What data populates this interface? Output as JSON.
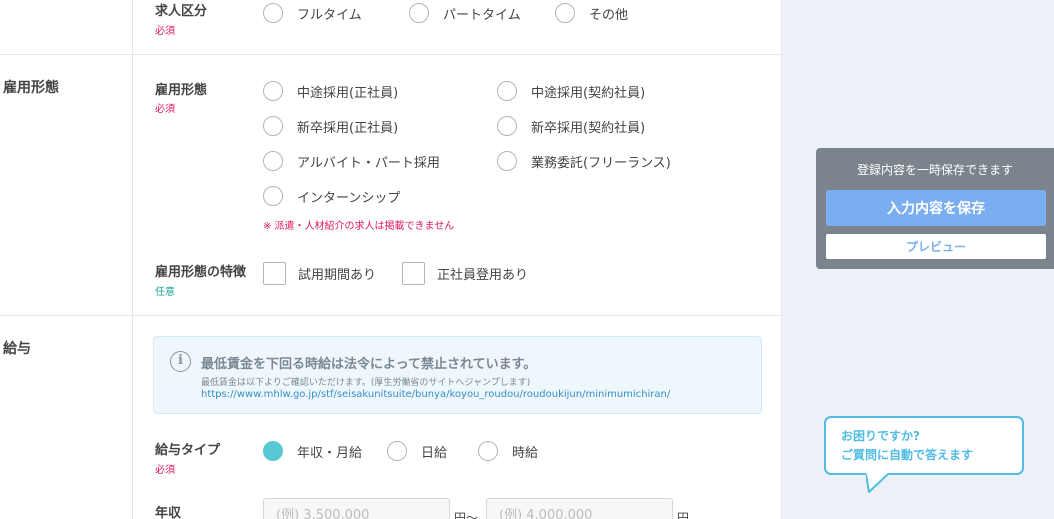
{
  "job_category": {
    "label": "求人区分",
    "required": "必須",
    "options": [
      "フルタイム",
      "パートタイム",
      "その他"
    ]
  },
  "employment": {
    "section_title": "雇用形態",
    "type_label": "雇用形態",
    "type_required": "必須",
    "options": [
      "中途採用(正社員)",
      "中途採用(契約社員)",
      "新卒採用(正社員)",
      "新卒採用(契約社員)",
      "アルバイト・パート採用",
      "業務委託(フリーランス)",
      "インターンシップ"
    ],
    "warning": "※ 派遣・人材紹介の求人は掲載できません",
    "feature_label": "雇用形態の特徴",
    "feature_optional": "任意",
    "feature_options": [
      "試用期間あり",
      "正社員登用あり"
    ]
  },
  "salary": {
    "section_title": "給与",
    "notice_icon": "i",
    "notice_title": "最低賃金を下回る時給は法令によって禁止されています。",
    "notice_sub": "最低賃金は以下よりご確認いただけます。(厚生労働省のサイトへジャンプします)",
    "notice_link": "https://www.mhlw.go.jp/stf/seisakunitsuite/bunya/koyou_roudou/roudoukijun/minimumichiran/",
    "type_label": "給与タイプ",
    "type_required": "必須",
    "type_options": [
      "年収・月給",
      "日給",
      "時給"
    ],
    "type_selected": "年収・月給",
    "annual_label": "年収",
    "min_placeholder": "(例) 3,500,000",
    "max_placeholder": "(例) 4,000,000",
    "unit_range": "円〜",
    "unit_end": "円"
  },
  "save_panel": {
    "title": "登録内容を一時保存できます",
    "save_label": "入力内容を保存",
    "preview_label": "プレビュー"
  },
  "help": {
    "line1": "お困りですか?",
    "line2": "ご質問に自動で答えます"
  },
  "colors": {
    "required": "#e0195b",
    "optional": "#14a38f",
    "accent": "#58c8d4",
    "save_button": "#7aaef0",
    "help": "#52bce5"
  }
}
